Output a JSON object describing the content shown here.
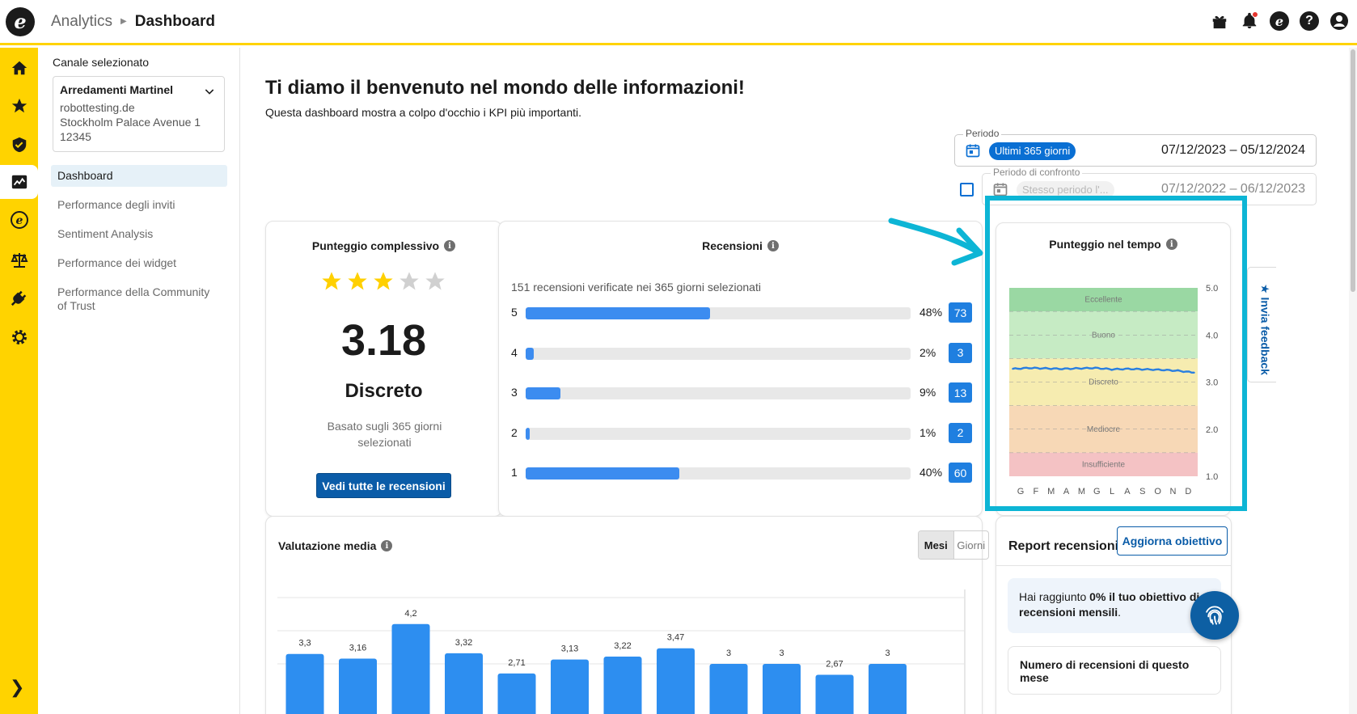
{
  "header": {
    "breadcrumb": [
      "Analytics",
      "Dashboard"
    ],
    "icons": [
      "gift-icon",
      "bell-icon",
      "trusted-shops-icon",
      "help-icon",
      "account-icon"
    ]
  },
  "rail": {
    "icons": [
      "home-icon",
      "star-icon",
      "shield-icon",
      "analytics-icon",
      "etrusted-icon",
      "scales-icon",
      "plug-icon",
      "gear-icon"
    ],
    "active": "analytics-icon"
  },
  "sidenav": {
    "channel_label": "Canale selezionato",
    "channel": {
      "name": "Arredamenti Martinel",
      "line1": "robottesting.de",
      "line2": "Stockholm Palace Avenue 1",
      "line3": "12345"
    },
    "items": [
      {
        "label": "Dashboard"
      },
      {
        "label": "Performance degli inviti"
      },
      {
        "label": "Sentiment Analysis"
      },
      {
        "label": "Performance dei widget"
      },
      {
        "label": "Performance della Community of Trust"
      }
    ]
  },
  "main": {
    "title": "Ti diamo il benvenuto nel mondo delle informazioni!",
    "subtitle": "Questa dashboard mostra a colpo d'occhio i KPI più importanti.",
    "period": {
      "label": "Periodo",
      "chip": "Ultimi 365 giorni",
      "dates": "07/12/2023 – 05/12/2024"
    },
    "compare": {
      "label": "Periodo di confronto",
      "chip": "Stesso periodo l'...",
      "dates": "07/12/2022 – 06/12/2023"
    }
  },
  "overall": {
    "title": "Punteggio complessivo",
    "stars_filled": 3,
    "stars_total": 5,
    "score": "3.18",
    "quality": "Discreto",
    "based_on": "Basato sugli 365 giorni selezionati",
    "button": "Vedi tutte le recensioni",
    "colors": {
      "star": "#ffd000",
      "star_empty": "#d0d0d0"
    }
  },
  "reviews": {
    "title": "Recensioni",
    "note": "151 recensioni verificate nei 365 giorni selezionati",
    "rows": [
      {
        "stars": "5",
        "pct": "48%",
        "fraction": 0.48,
        "count": "73"
      },
      {
        "stars": "4",
        "pct": "2%",
        "fraction": 0.02,
        "count": "3"
      },
      {
        "stars": "3",
        "pct": "9%",
        "fraction": 0.09,
        "count": "13"
      },
      {
        "stars": "2",
        "pct": "1%",
        "fraction": 0.01,
        "count": "2"
      },
      {
        "stars": "1",
        "pct": "40%",
        "fraction": 0.4,
        "count": "60"
      }
    ]
  },
  "feedback": {
    "label": "★ Invia feedback"
  },
  "chart_data": [
    {
      "type": "line",
      "title": "Punteggio nel tempo",
      "categories": [
        "G",
        "F",
        "M",
        "A",
        "M",
        "G",
        "L",
        "A",
        "S",
        "O",
        "N",
        "D"
      ],
      "ylim": [
        1.0,
        5.0
      ],
      "yticks": [
        "5.0",
        "4.0",
        "3.0",
        "2.0",
        "1.0"
      ],
      "bands": [
        {
          "name": "Eccellente",
          "from": 4.5,
          "to": 5.0,
          "color": "#9ad8a3"
        },
        {
          "name": "Buono",
          "from": 3.5,
          "to": 4.5,
          "color": "#c6ebc4"
        },
        {
          "name": "Discreto",
          "from": 2.5,
          "to": 3.5,
          "color": "#f6ecb0"
        },
        {
          "name": "Mediocre",
          "from": 1.5,
          "to": 2.5,
          "color": "#f7d8b6"
        },
        {
          "name": "Insufficiente",
          "from": 1.0,
          "to": 1.5,
          "color": "#f4c2c4"
        }
      ],
      "values": [
        3.28,
        3.3,
        3.29,
        3.28,
        3.29,
        3.3,
        3.27,
        3.28,
        3.27,
        3.26,
        3.24,
        3.2
      ]
    },
    {
      "type": "bar",
      "title": "Valutazione media",
      "values": [
        3.3,
        3.16,
        4.2,
        3.32,
        2.71,
        3.13,
        3.22,
        3.47,
        3,
        3,
        2.67,
        3
      ],
      "labels": [
        "3,3",
        "3,16",
        "4,2",
        "3,32",
        "2,71",
        "3,13",
        "3,22",
        "3,47",
        "3",
        "3",
        "2,67",
        "3"
      ],
      "yticks": [
        "5.0",
        "4.0",
        "3.0"
      ],
      "ylim": [
        0,
        5.0
      ],
      "toggle": [
        "Mesi",
        "Giorni"
      ],
      "color": "#2d8ef0"
    }
  ],
  "report": {
    "title": "Report recensioni",
    "button": "Aggiorna obiettivo",
    "goal_prefix": "Hai raggiunto ",
    "goal_bold": "0% il tuo obiettivo di recensioni mensili",
    "goal_suffix": ".",
    "count_title": "Numero di recensioni di questo mese"
  }
}
